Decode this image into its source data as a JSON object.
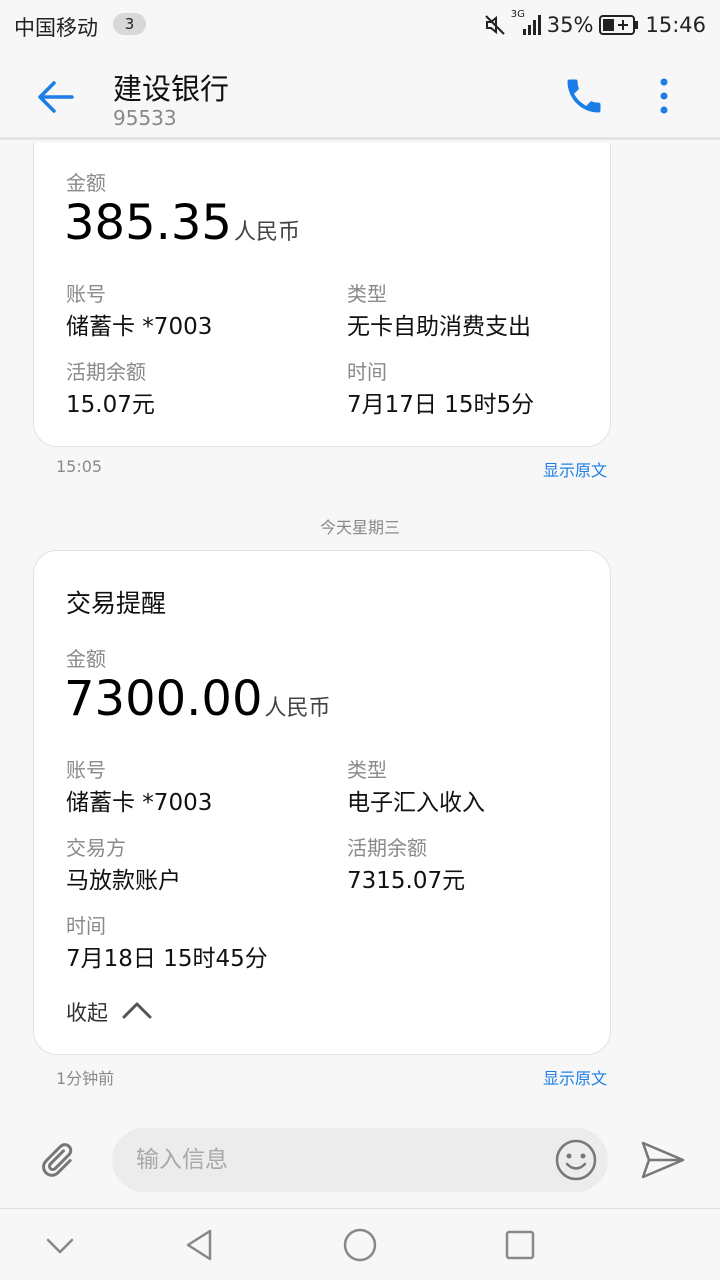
{
  "status_bar": {
    "carrier": "中国移动",
    "notification_count": "3",
    "network": "3G",
    "battery": "35%",
    "time": "15:46",
    "icons": [
      "mute-icon",
      "signal-icon",
      "battery-icon"
    ]
  },
  "header": {
    "title": "建设银行",
    "subtitle": "95533",
    "accent_color": "#1a7ee6"
  },
  "messages": [
    {
      "amount_label": "金额",
      "amount": "385.35",
      "currency": "人民币",
      "account_label": "账号",
      "account": "储蓄卡 *7003",
      "type_label": "类型",
      "type": "无卡自助消费支出",
      "balance_label": "活期余额",
      "balance": "15.07元",
      "time_label": "时间",
      "time": "7月17日 15时5分",
      "sent_time": "15:05",
      "show_original": "显示原文"
    },
    {
      "title": "交易提醒",
      "amount_label": "金额",
      "amount": "7300.00",
      "currency": "人民币",
      "account_label": "账号",
      "account": "储蓄卡 *7003",
      "type_label": "类型",
      "type": "电子汇入收入",
      "counterparty_label": "交易方",
      "counterparty": "马放款账户",
      "balance_label": "活期余额",
      "balance": "7315.07元",
      "time_label": "时间",
      "time": "7月18日 15时45分",
      "collapse_label": "收起",
      "sent_time": "1分钟前",
      "show_original": "显示原文"
    }
  ],
  "day_separator": "今天星期三",
  "compose": {
    "placeholder": "输入信息"
  }
}
